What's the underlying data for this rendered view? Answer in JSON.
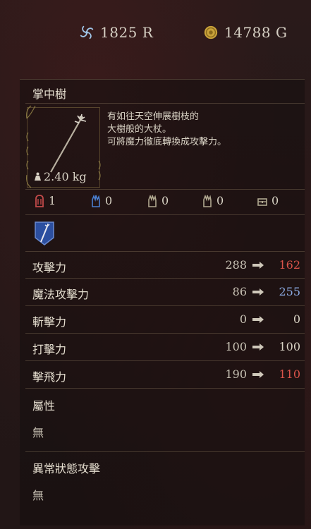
{
  "currency": {
    "runes": "1825 R",
    "gold": "14788 G",
    "runes_icon": "spiral-rune-icon",
    "gold_icon": "gold-coin-icon"
  },
  "item": {
    "name": "掌中樹",
    "weight": "2.40 kg",
    "description": [
      "有如往天空伸展樹枝的",
      "大樹般的大杖。",
      "可將魔力徹底轉換成攻擊力。"
    ],
    "image": "staff-image"
  },
  "requirements": [
    {
      "icon": "strength-icon",
      "value": "1"
    },
    {
      "icon": "intelligence-icon",
      "value": "0"
    },
    {
      "icon": "dexterity-icon",
      "value": "0"
    },
    {
      "icon": "faith-icon",
      "value": "0"
    },
    {
      "icon": "chest-icon",
      "value": "0"
    }
  ],
  "badge_icon": "staff-skill-badge-icon",
  "stats": [
    {
      "label": "攻擊力",
      "current": "288",
      "new": "162",
      "trend": "down"
    },
    {
      "label": "魔法攻擊力",
      "current": "86",
      "new": "255",
      "trend": "up"
    },
    {
      "label": "斬擊力",
      "current": "0",
      "new": "0",
      "trend": "same"
    },
    {
      "label": "打擊力",
      "current": "100",
      "new": "100",
      "trend": "same"
    },
    {
      "label": "擊飛力",
      "current": "190",
      "new": "110",
      "trend": "down"
    }
  ],
  "attribute": {
    "title": "屬性",
    "value": "無"
  },
  "status_effect": {
    "title": "異常狀態攻擊",
    "value": "無"
  },
  "colors": {
    "down": "#d9534a",
    "up": "#8aa8e0",
    "same": "#d8d2c4"
  }
}
